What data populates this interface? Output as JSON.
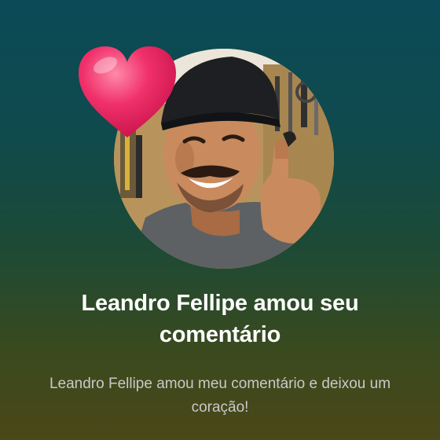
{
  "notification": {
    "title": "Leandro Fellipe amou seu comentário",
    "message": "Leandro Fellipe amou meu comentário e deixou um coração!",
    "reaction_icon": "heart-icon",
    "colors": {
      "background_top": "#0b4a57",
      "background_bottom": "#4a4718",
      "heart": "#f0306a",
      "title_text": "#ffffff",
      "message_text": "#c9c9c9"
    }
  }
}
